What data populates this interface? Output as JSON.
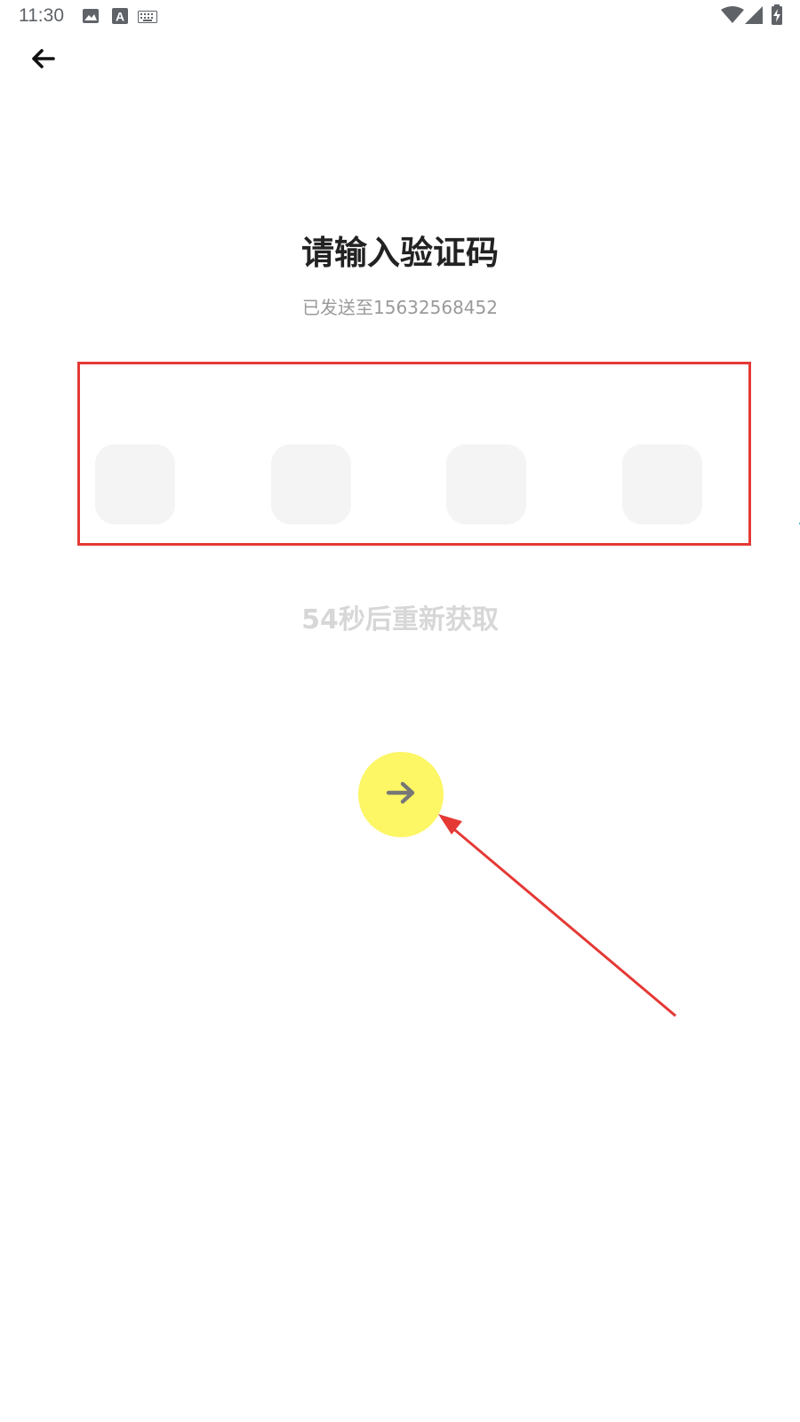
{
  "status_bar": {
    "time": "11:30",
    "icons": [
      "image-icon",
      "text-a-icon",
      "keyboard-icon",
      "wifi-icon",
      "signal-icon",
      "battery-charging-icon"
    ]
  },
  "nav": {
    "back_icon": "arrow-left-icon"
  },
  "verify": {
    "title": "请输入验证码",
    "sent_to": "已发送至15632568452",
    "code_cells": [
      "",
      "",
      "",
      ""
    ],
    "resend_countdown": "54秒后重新获取"
  },
  "next_button": {
    "icon": "arrow-right-icon",
    "color": "#fdf665"
  },
  "annotation": {
    "highlight_color": "#e53935"
  }
}
